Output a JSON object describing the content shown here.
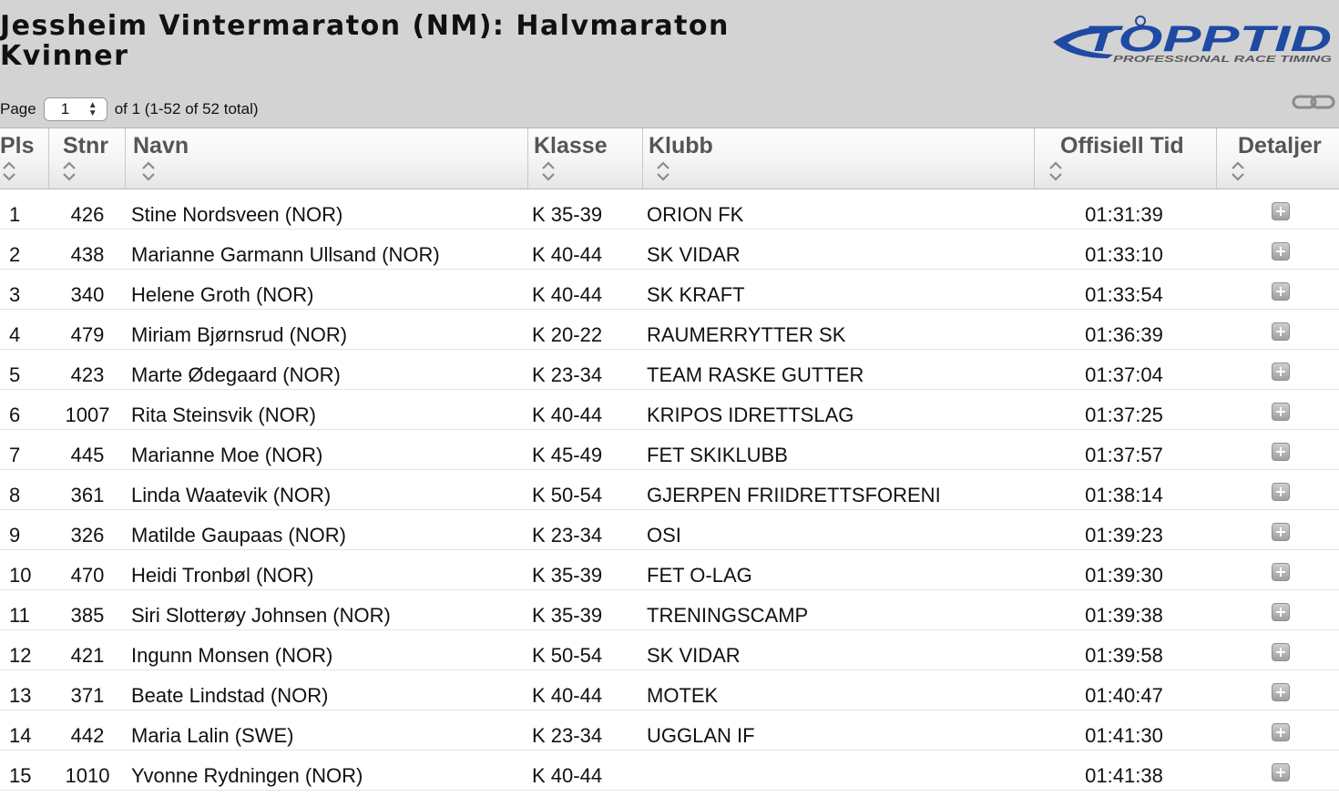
{
  "page": {
    "title_line1": "Jessheim Vintermaraton (NM): Halvmaraton",
    "title_line2": "Kvinner",
    "logo": {
      "text": "TOPPTID",
      "tagline": "PROFESSIONAL RACE TIMING",
      "color": "#1f4aa3"
    }
  },
  "pager": {
    "label": "Page",
    "current": "1",
    "summary": "of 1 (1-52 of 52 total)"
  },
  "icons": {
    "link": "link-icon",
    "sort": "sort-arrows-icon",
    "details": "plus-icon"
  },
  "table": {
    "columns": [
      {
        "key": "pls",
        "label": "Pls"
      },
      {
        "key": "stnr",
        "label": "Stnr"
      },
      {
        "key": "navn",
        "label": "Navn"
      },
      {
        "key": "klasse",
        "label": "Klasse"
      },
      {
        "key": "klubb",
        "label": "Klubb"
      },
      {
        "key": "tid",
        "label": "Offisiell Tid"
      },
      {
        "key": "detaljer",
        "label": "Detaljer"
      }
    ],
    "rows": [
      {
        "pls": "1",
        "stnr": "426",
        "navn": "Stine Nordsveen (NOR)",
        "klasse": "K 35-39",
        "klubb": "ORION FK",
        "tid": "01:31:39"
      },
      {
        "pls": "2",
        "stnr": "438",
        "navn": "Marianne Garmann Ullsand (NOR)",
        "klasse": "K 40-44",
        "klubb": "SK VIDAR",
        "tid": "01:33:10"
      },
      {
        "pls": "3",
        "stnr": "340",
        "navn": "Helene Groth (NOR)",
        "klasse": "K 40-44",
        "klubb": "SK KRAFT",
        "tid": "01:33:54"
      },
      {
        "pls": "4",
        "stnr": "479",
        "navn": "Miriam Bjørnsrud (NOR)",
        "klasse": "K 20-22",
        "klubb": "RAUMERRYTTER SK",
        "tid": "01:36:39"
      },
      {
        "pls": "5",
        "stnr": "423",
        "navn": "Marte Ødegaard (NOR)",
        "klasse": "K 23-34",
        "klubb": "TEAM RASKE GUTTER",
        "tid": "01:37:04"
      },
      {
        "pls": "6",
        "stnr": "1007",
        "navn": "Rita Steinsvik (NOR)",
        "klasse": "K 40-44",
        "klubb": "KRIPOS IDRETTSLAG",
        "tid": "01:37:25"
      },
      {
        "pls": "7",
        "stnr": "445",
        "navn": "Marianne Moe (NOR)",
        "klasse": "K 45-49",
        "klubb": "FET SKIKLUBB",
        "tid": "01:37:57"
      },
      {
        "pls": "8",
        "stnr": "361",
        "navn": "Linda Waatevik (NOR)",
        "klasse": "K 50-54",
        "klubb": "GJERPEN FRIIDRETTSFORENI",
        "tid": "01:38:14"
      },
      {
        "pls": "9",
        "stnr": "326",
        "navn": "Matilde Gaupaas (NOR)",
        "klasse": "K 23-34",
        "klubb": "OSI",
        "tid": "01:39:23"
      },
      {
        "pls": "10",
        "stnr": "470",
        "navn": "Heidi Tronbøl (NOR)",
        "klasse": "K 35-39",
        "klubb": "FET O-LAG",
        "tid": "01:39:30"
      },
      {
        "pls": "11",
        "stnr": "385",
        "navn": "Siri Slotterøy Johnsen (NOR)",
        "klasse": "K 35-39",
        "klubb": "TRENINGSCAMP",
        "tid": "01:39:38"
      },
      {
        "pls": "12",
        "stnr": "421",
        "navn": "Ingunn Monsen (NOR)",
        "klasse": "K 50-54",
        "klubb": "SK VIDAR",
        "tid": "01:39:58"
      },
      {
        "pls": "13",
        "stnr": "371",
        "navn": "Beate Lindstad (NOR)",
        "klasse": "K 40-44",
        "klubb": "MOTEK",
        "tid": "01:40:47"
      },
      {
        "pls": "14",
        "stnr": "442",
        "navn": "Maria Lalin (SWE)",
        "klasse": "K 23-34",
        "klubb": "UGGLAN IF",
        "tid": "01:41:30"
      },
      {
        "pls": "15",
        "stnr": "1010",
        "navn": "Yvonne Rydningen (NOR)",
        "klasse": "K 40-44",
        "klubb": "",
        "tid": "01:41:38"
      }
    ]
  }
}
